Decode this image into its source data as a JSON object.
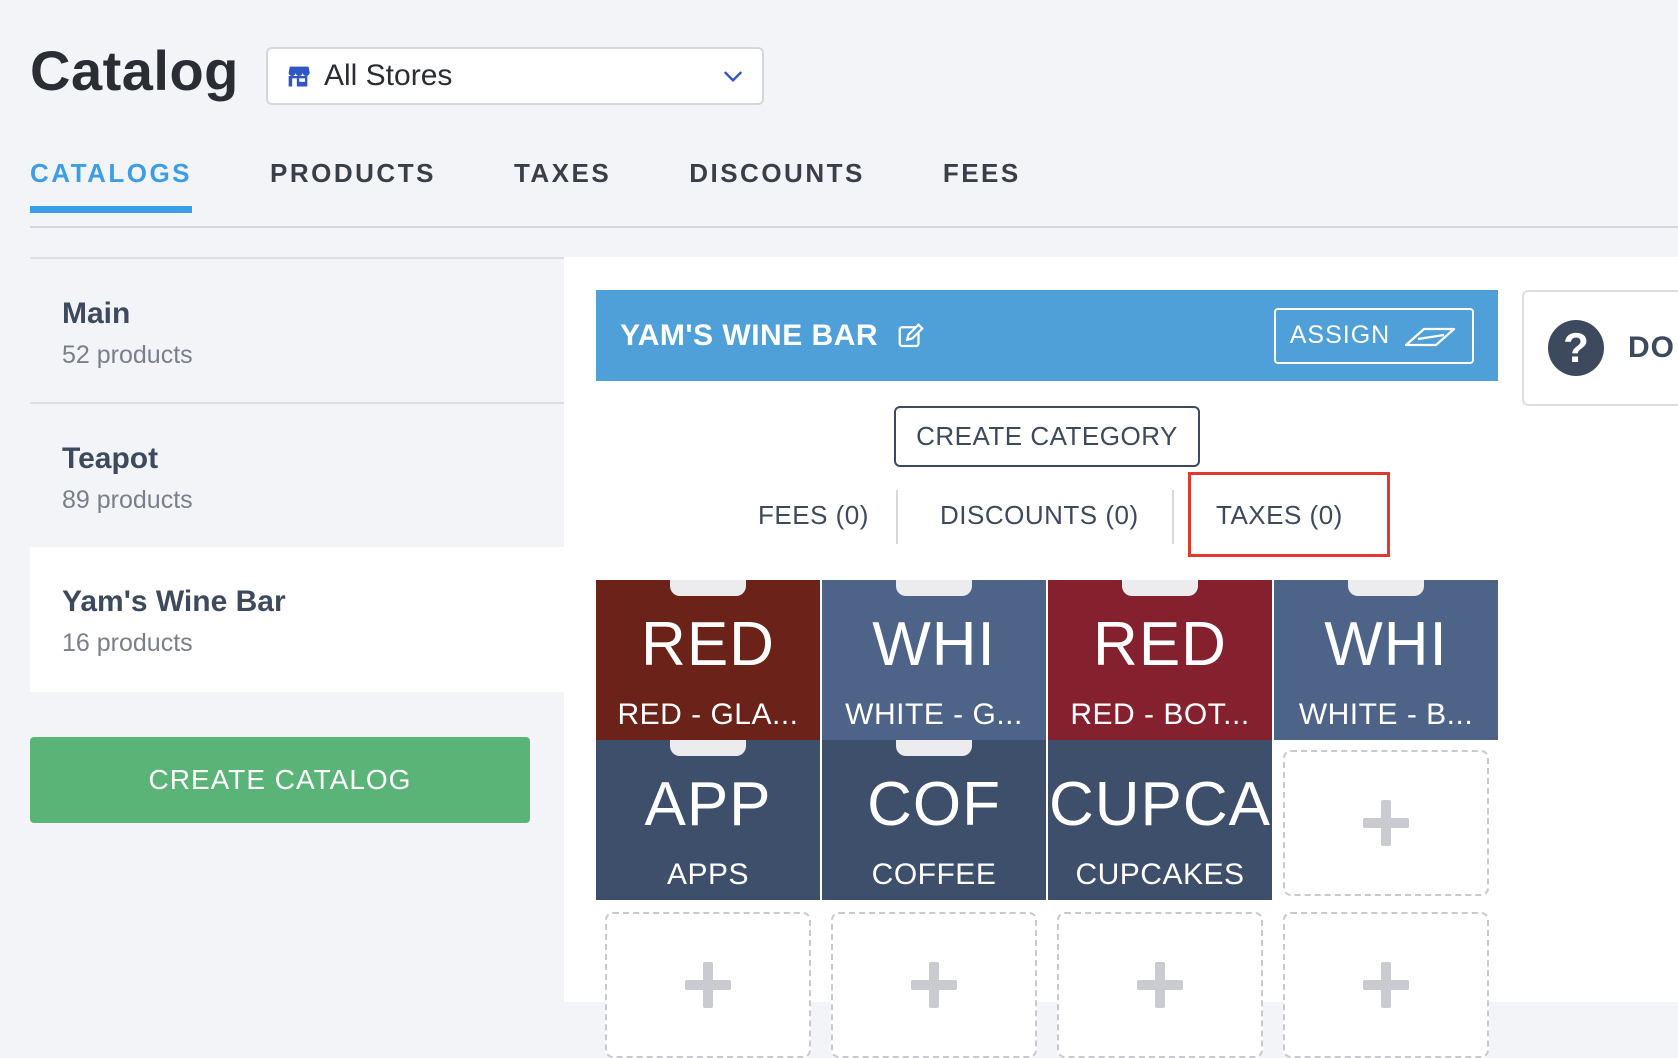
{
  "header": {
    "title": "Catalog",
    "store_select": {
      "value": "All Stores"
    }
  },
  "tabs": [
    {
      "label": "CATALOGS",
      "active": true
    },
    {
      "label": "PRODUCTS"
    },
    {
      "label": "TAXES"
    },
    {
      "label": "DISCOUNTS"
    },
    {
      "label": "FEES"
    }
  ],
  "catalogs": [
    {
      "name": "Main",
      "count": "52 products"
    },
    {
      "name": "Teapot",
      "count": "89 products"
    },
    {
      "name": "Yam's Wine Bar",
      "count": "16 products",
      "selected": true
    }
  ],
  "create_catalog_label": "CREATE CATALOG",
  "catalog_header": {
    "title": "YAM'S WINE BAR",
    "assign_label": "ASSIGN"
  },
  "create_category_label": "CREATE CATEGORY",
  "filters": {
    "fees": "FEES (0)",
    "discounts": "DISCOUNTS (0)",
    "taxes": "TAXES (0)"
  },
  "tiles": [
    {
      "big": "RED",
      "small": "RED - GLA...",
      "color": "#6b2218"
    },
    {
      "big": "WHI",
      "small": "WHITE - G...",
      "color": "#4e6388"
    },
    {
      "big": "RED",
      "small": "RED - BOT...",
      "color": "#85212f"
    },
    {
      "big": "WHI",
      "small": "WHITE - B...",
      "color": "#4e6388"
    },
    {
      "big": "APP",
      "small": "APPS",
      "color": "#3e4f6c"
    },
    {
      "big": "COF",
      "small": "COFFEE",
      "color": "#3e4f6c"
    },
    {
      "big": "CUPCA",
      "small": "CUPCAKES",
      "color": "#3e4f6c"
    }
  ],
  "help_card": {
    "text": "DO"
  }
}
